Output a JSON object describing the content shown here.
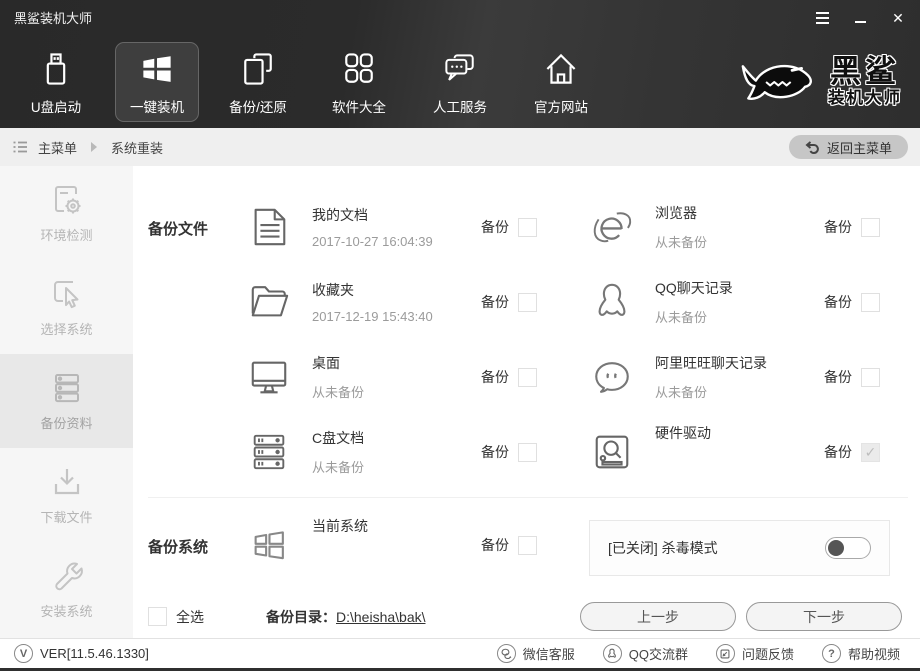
{
  "window": {
    "title": "黑鲨装机大师"
  },
  "nav": {
    "items": [
      {
        "label": "U盘启动"
      },
      {
        "label": "一键装机"
      },
      {
        "label": "备份/还原"
      },
      {
        "label": "软件大全"
      },
      {
        "label": "人工服务"
      },
      {
        "label": "官方网站"
      }
    ],
    "logo_line1": "黑鲨",
    "logo_line2": "装机大师"
  },
  "breadcrumb": {
    "root": "主菜单",
    "current": "系统重装",
    "back_button": "返回主菜单"
  },
  "sidebar": {
    "items": [
      {
        "label": "环境检测"
      },
      {
        "label": "选择系统"
      },
      {
        "label": "备份资料"
      },
      {
        "label": "下载文件"
      },
      {
        "label": "安装系统"
      }
    ]
  },
  "backup": {
    "files_section_label": "备份文件",
    "system_section_label": "备份系统",
    "backup_label": "备份",
    "file_items": [
      {
        "icon": "document-icon",
        "title": "我的文档",
        "subtitle": "2017-10-27 16:04:39",
        "checked": false
      },
      {
        "icon": "browser-icon",
        "title": "浏览器",
        "subtitle": "从未备份",
        "checked": false
      },
      {
        "icon": "folder-icon",
        "title": "收藏夹",
        "subtitle": "2017-12-19 15:43:40",
        "checked": false
      },
      {
        "icon": "qq-icon",
        "title": "QQ聊天记录",
        "subtitle": "从未备份",
        "checked": false
      },
      {
        "icon": "desktop-icon",
        "title": "桌面",
        "subtitle": "从未备份",
        "checked": false
      },
      {
        "icon": "wangwang-icon",
        "title": "阿里旺旺聊天记录",
        "subtitle": "从未备份",
        "checked": false
      },
      {
        "icon": "cdrive-icon",
        "title": "C盘文档",
        "subtitle": "从未备份",
        "checked": false
      },
      {
        "icon": "driver-icon",
        "title": "硬件驱动",
        "subtitle": "",
        "checked": true,
        "disabled": true
      }
    ],
    "system_item": {
      "icon": "windows-icon",
      "title": "当前系统",
      "checked": false
    },
    "antivirus": {
      "label": "[已关闭] 杀毒模式",
      "enabled": false
    },
    "select_all_label": "全选",
    "backup_dir_label": "备份目录：",
    "backup_dir_value": "D:\\heisha\\bak\\",
    "prev_button": "上一步",
    "next_button": "下一步"
  },
  "footer": {
    "version": "VER[11.5.46.1330]",
    "version_icon_letter": "V",
    "help_icon_letter": "?",
    "links": [
      {
        "label": "微信客服"
      },
      {
        "label": "QQ交流群"
      },
      {
        "label": "问题反馈"
      },
      {
        "label": "帮助视频"
      }
    ]
  }
}
